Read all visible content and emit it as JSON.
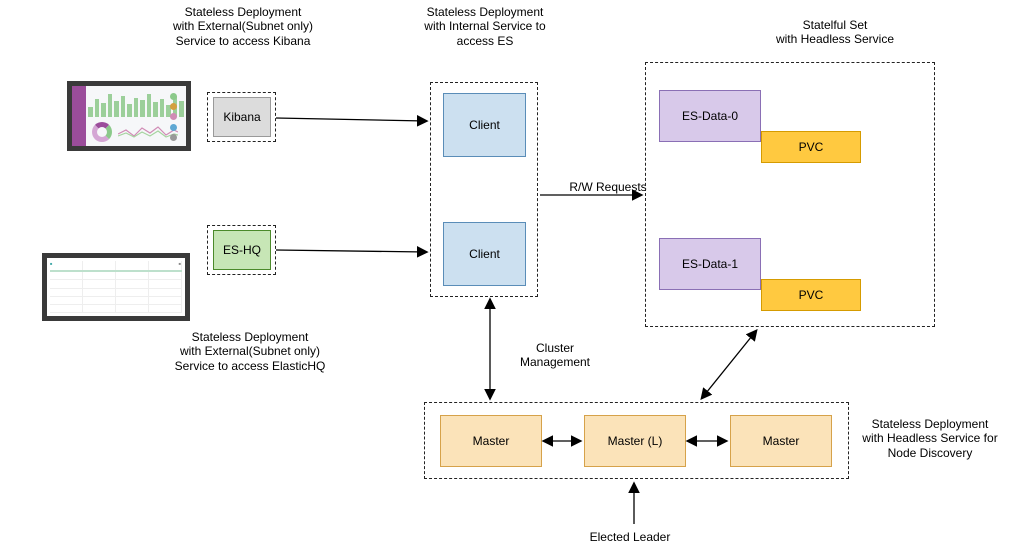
{
  "captions": {
    "kibana_dep": "Stateless Deployment\nwith External(Subnet only)\nService to access Kibana",
    "client_dep": "Stateless Deployment\nwith Internal Service to\naccess ES",
    "stateful": "Statelful Set\nwith Headless Service",
    "eshq_dep": "Stateless Deployment\nwith External(Subnet only)\nService to access ElasticHQ",
    "master_dep": "Stateless Deployment\nwith Headless Service for\nNode Discovery",
    "rw_requests": "R/W Requests",
    "cluster_mgmt": "Cluster\nManagement",
    "elected_leader": "Elected Leader"
  },
  "nodes": {
    "kibana": "Kibana",
    "eshq": "ES-HQ",
    "client1": "Client",
    "client2": "Client",
    "esdata0": "ES-Data-0",
    "esdata1": "ES-Data-1",
    "pvc0": "PVC",
    "pvc1": "PVC",
    "master1": "Master",
    "master2": "Master (L)",
    "master3": "Master"
  },
  "colors": {
    "kibana_box": "#dcdcdc",
    "eshq_box": "#c7e6b6",
    "eshq_border": "#4b8a2a",
    "client_box": "#cce0f0",
    "client_border": "#5a8db8",
    "esdata_box": "#d8c9ea",
    "esdata_border": "#8a6fb5",
    "pvc_box": "#ffc940",
    "pvc_border": "#d59b00",
    "master_box": "#fbe3b9",
    "master_border": "#d6a24a"
  }
}
